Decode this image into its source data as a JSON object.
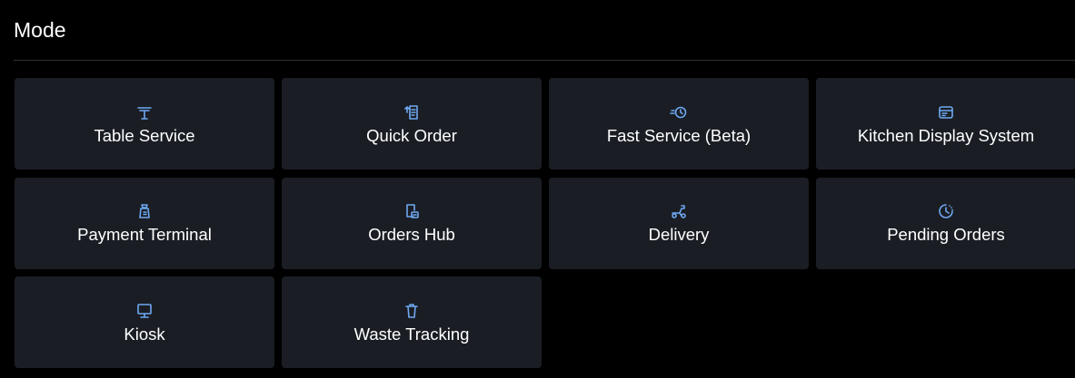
{
  "page": {
    "title": "Mode"
  },
  "accent_color": "#6ea8f2",
  "tile_background": "#1a1e24",
  "modes": [
    {
      "label": "Table Service",
      "icon": "table-icon"
    },
    {
      "label": "Quick Order",
      "icon": "quick-order-icon"
    },
    {
      "label": "Fast Service (Beta)",
      "icon": "fast-service-icon"
    },
    {
      "label": "Kitchen Display System",
      "icon": "kitchen-display-icon"
    },
    {
      "label": "Payment Terminal",
      "icon": "payment-terminal-icon"
    },
    {
      "label": "Orders Hub",
      "icon": "orders-hub-icon"
    },
    {
      "label": "Delivery",
      "icon": "delivery-scooter-icon"
    },
    {
      "label": "Pending Orders",
      "icon": "clock-icon"
    },
    {
      "label": "Kiosk",
      "icon": "kiosk-monitor-icon"
    },
    {
      "label": "Waste Tracking",
      "icon": "trash-icon"
    }
  ]
}
